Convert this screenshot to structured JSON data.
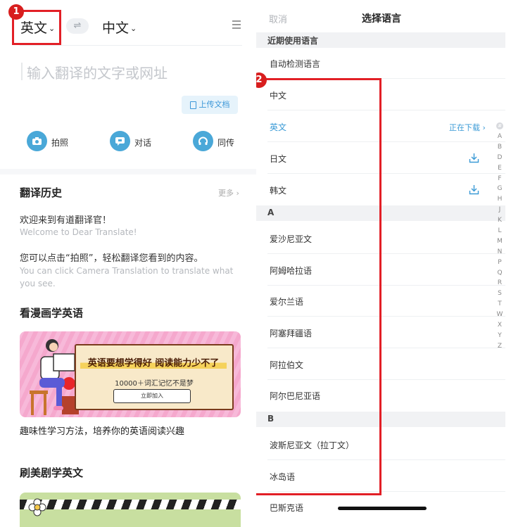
{
  "left": {
    "source_lang": "英文",
    "target_lang": "中文",
    "swap_icon": "⇌",
    "input_placeholder": "输入翻译的文字或网址",
    "upload_label": "上传文档",
    "tools": [
      "拍照",
      "对话",
      "同传"
    ],
    "history": {
      "title": "翻译历史",
      "more": "更多 ›",
      "welcome_cn": "欢迎来到有道翻译官！",
      "welcome_en": "Welcome to Dear Translate!",
      "tip_cn": "您可以点击“拍照”，轻松翻译您看到的内容。",
      "tip_en": "You can click Camera Translation to translate what you see."
    },
    "comic": {
      "title": "看漫画学英语",
      "banner_headline": "英语要想学得好 阅读能力少不了",
      "banner_sub": "10000＋词汇记忆不是梦",
      "banner_button": "立即加入",
      "caption": "趣味性学习方法，培养你的英语阅读兴趣"
    },
    "drama": {
      "title": "刷美剧学英文"
    },
    "annotation_badge": "1"
  },
  "right": {
    "cancel": "取消",
    "title": "选择语言",
    "recent_section": "近期使用语言",
    "auto_detect": "自动检测语言",
    "languages_top": [
      "中文",
      "英文",
      "日文",
      "韩文"
    ],
    "downloading_status": "正在下载 ›",
    "section_a": "A",
    "languages_a": [
      "爱沙尼亚文",
      "阿姆哈拉语",
      "爱尔兰语",
      "阿塞拜疆语",
      "阿拉伯文",
      "阿尔巴尼亚语"
    ],
    "section_b": "B",
    "languages_b": [
      "波斯尼亚文（拉丁文）",
      "冰岛语",
      "巴斯克语"
    ],
    "alphabet_index": [
      "#",
      "A",
      "B",
      "D",
      "E",
      "F",
      "G",
      "H",
      "J",
      "K",
      "L",
      "M",
      "N",
      "P",
      "Q",
      "R",
      "S",
      "T",
      "W",
      "X",
      "Y",
      "Z"
    ],
    "annotation_badge": "2"
  },
  "colors": {
    "accent": "#3a9ad6",
    "annotation_red": "#e21f26"
  }
}
